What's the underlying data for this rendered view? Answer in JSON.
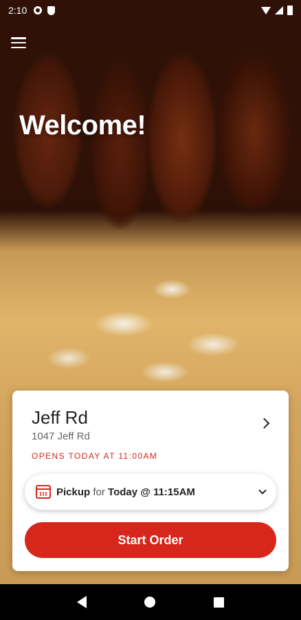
{
  "status_bar": {
    "time": "2:10",
    "icons": [
      "gear-icon",
      "shield-icon",
      "wifi-icon",
      "signal-icon",
      "battery-icon"
    ]
  },
  "header": {
    "menu_icon": "hamburger-menu-icon",
    "welcome": "Welcome!"
  },
  "location": {
    "name": "Jeff Rd",
    "address": "1047 Jeff Rd",
    "hours": "OPENS TODAY AT 11:00AM"
  },
  "pickup": {
    "mode": "Pickup",
    "connector": "for",
    "time": "Today @ 11:15AM",
    "icon": "calendar-icon"
  },
  "actions": {
    "start_order": "Start Order"
  },
  "colors": {
    "accent": "#d7261b",
    "text": "#222222",
    "muted": "#666666"
  },
  "nav_bar": {
    "icons": [
      "back-icon",
      "home-icon",
      "recents-icon"
    ]
  }
}
